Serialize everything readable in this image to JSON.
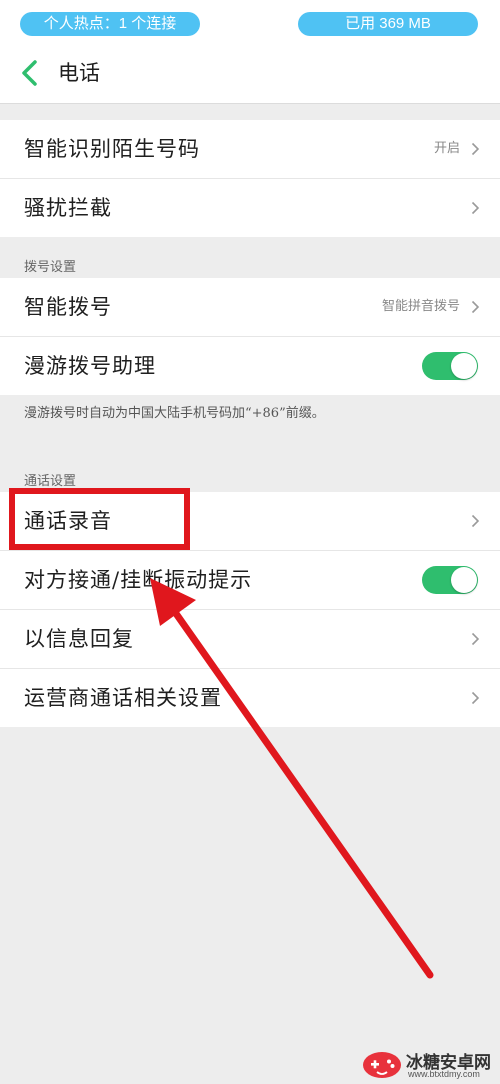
{
  "status_bar": {
    "hotspot": "个人热点：1 个连接",
    "usage": "已用 369 MB"
  },
  "header": {
    "title": "电话",
    "back_icon": "chevron-left-icon"
  },
  "groups": {
    "g1": {
      "smart_id": {
        "label": "智能识别陌生号码",
        "value": "开启"
      },
      "harass": {
        "label": "骚扰拦截"
      }
    },
    "dial": {
      "section_label": "拨号设置",
      "smart_dial": {
        "label": "智能拨号",
        "value": "智能拼音拨号"
      },
      "roaming": {
        "label": "漫游拨号助理",
        "toggle_on": true
      },
      "footnote": "漫游拨号时自动为中国大陆手机号码加“+86”前缀。"
    },
    "call": {
      "section_label": "通话设置",
      "recording": {
        "label": "通话录音"
      },
      "vibrate": {
        "label": "对方接通/挂断振动提示",
        "toggle_on": true
      },
      "sms_reply": {
        "label": "以信息回复"
      },
      "operator": {
        "label": "运营商通话相关设置"
      }
    }
  },
  "watermark": {
    "name": "冰糖安卓网",
    "url": "www.btxtdmy.com"
  },
  "colors": {
    "accent_green": "#2fbe6e",
    "pill_blue": "#4fc2f3",
    "annotation_red": "#e0171d"
  }
}
